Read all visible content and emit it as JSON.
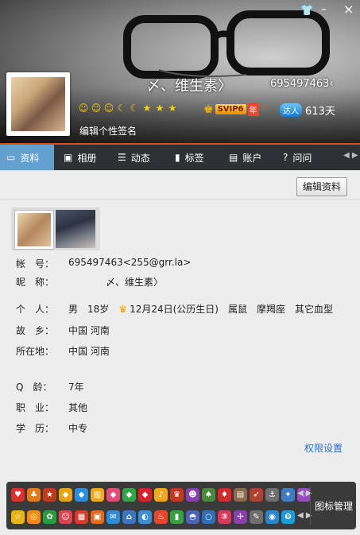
{
  "header": {
    "nickname": "〆、维生素〉",
    "qq_number": "695497463‹",
    "signature_prompt": "编辑个性签名",
    "svip_label": "SVIP6",
    "svip_year": "年",
    "daren_badge": "达人",
    "active_days": "613天"
  },
  "tabs": [
    {
      "label": "资料"
    },
    {
      "label": "相册"
    },
    {
      "label": "动态"
    },
    {
      "label": "标签"
    },
    {
      "label": "账户"
    },
    {
      "label": "问问"
    }
  ],
  "content": {
    "edit_button": "编辑资料",
    "fields": {
      "account_label": "帐　号：",
      "account_value": "695497463<255@grr.la>",
      "nick_label": "昵　称：",
      "nick_value": "〆、维生素〉",
      "person_label": "个　人：",
      "gender": "男",
      "age": "18岁",
      "birthday": "12月24日(公历生日)",
      "zodiac_animal": "属鼠",
      "constellation": "摩羯座",
      "blood_type": "其它血型",
      "hometown_label": "故　乡：",
      "hometown_value": "中国 河南",
      "location_label": "所在地：",
      "location_value": "中国 河南",
      "qage_label": "Q　龄：",
      "qage_value": "7年",
      "job_label": "职　业：",
      "job_value": "其他",
      "edu_label": "学　历：",
      "edu_value": "中专"
    },
    "permission_link": "权限设置"
  },
  "tray": {
    "label": "图标管理"
  }
}
